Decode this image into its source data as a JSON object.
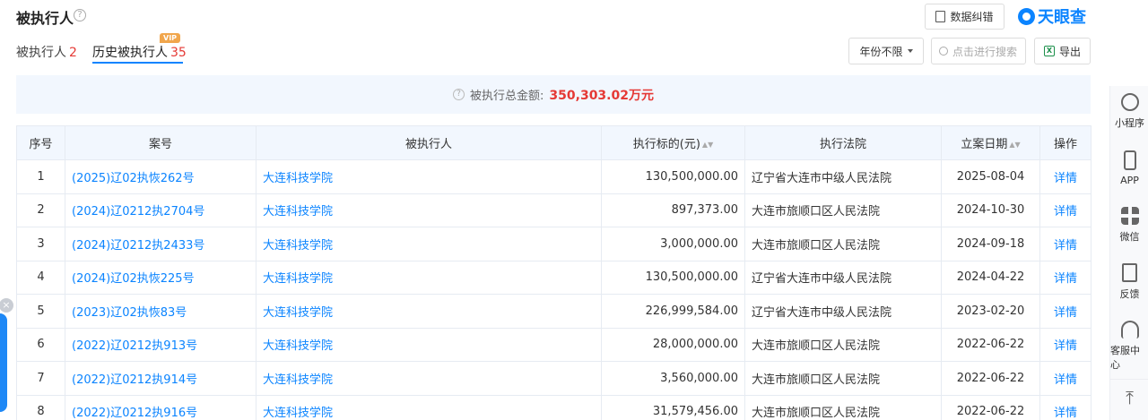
{
  "header": {
    "title": "被执行人",
    "correct_label": "数据纠错",
    "logo_text": "天眼查"
  },
  "tabs": [
    {
      "label": "被执行人",
      "count": "2"
    },
    {
      "label": "历史被执行人",
      "count": "35",
      "badge": "VIP"
    }
  ],
  "filters": {
    "year_label": "年份不限",
    "search_placeholder": "点击进行搜索",
    "export_label": "导出"
  },
  "summary": {
    "label": "被执行总金额:",
    "amount": "350,303.02万元"
  },
  "table": {
    "headers": [
      "序号",
      "案号",
      "被执行人",
      "执行标的(元)",
      "执行法院",
      "立案日期",
      "操作"
    ],
    "rows": [
      {
        "no": "1",
        "case": "(2025)辽02执恢262号",
        "party": "大连科技学院",
        "amount": "130,500,000.00",
        "court": "辽宁省大连市中级人民法院",
        "date": "2025-08-04",
        "action": "详情"
      },
      {
        "no": "2",
        "case": "(2024)辽0212执2704号",
        "party": "大连科技学院",
        "amount": "897,373.00",
        "court": "大连市旅顺口区人民法院",
        "date": "2024-10-30",
        "action": "详情"
      },
      {
        "no": "3",
        "case": "(2024)辽0212执2433号",
        "party": "大连科技学院",
        "amount": "3,000,000.00",
        "court": "大连市旅顺口区人民法院",
        "date": "2024-09-18",
        "action": "详情"
      },
      {
        "no": "4",
        "case": "(2024)辽02执恢225号",
        "party": "大连科技学院",
        "amount": "130,500,000.00",
        "court": "辽宁省大连市中级人民法院",
        "date": "2024-04-22",
        "action": "详情"
      },
      {
        "no": "5",
        "case": "(2023)辽02执恢83号",
        "party": "大连科技学院",
        "amount": "226,999,584.00",
        "court": "辽宁省大连市中级人民法院",
        "date": "2023-02-20",
        "action": "详情"
      },
      {
        "no": "6",
        "case": "(2022)辽0212执913号",
        "party": "大连科技学院",
        "amount": "28,000,000.00",
        "court": "大连市旅顺口区人民法院",
        "date": "2022-06-22",
        "action": "详情"
      },
      {
        "no": "7",
        "case": "(2022)辽0212执914号",
        "party": "大连科技学院",
        "amount": "3,560,000.00",
        "court": "大连市旅顺口区人民法院",
        "date": "2022-06-22",
        "action": "详情"
      },
      {
        "no": "8",
        "case": "(2022)辽0212执916号",
        "party": "大连科技学院",
        "amount": "31,579,456.00",
        "court": "大连市旅顺口区人民法院",
        "date": "2022-06-22",
        "action": "详情"
      }
    ]
  },
  "sidebar": {
    "items": [
      {
        "label": "小程序",
        "icon": "mini-program-icon"
      },
      {
        "label": "APP",
        "icon": "phone-icon"
      },
      {
        "label": "微信",
        "icon": "qrcode-icon"
      },
      {
        "label": "反馈",
        "icon": "edit-icon"
      },
      {
        "label": "客服中心",
        "icon": "headset-icon"
      }
    ],
    "top_icon": "back-to-top-icon"
  },
  "colors": {
    "accent": "#0b84ff",
    "amount_red": "#e53935",
    "header_bg": "#f2f7fe"
  }
}
